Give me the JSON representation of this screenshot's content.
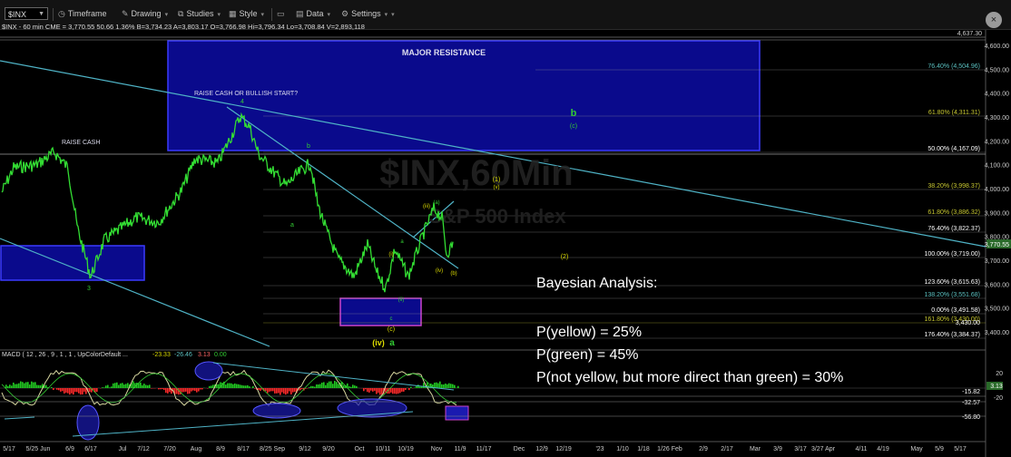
{
  "toolbar": {
    "symbol": "$INX",
    "timeframe": "Timeframe",
    "drawing": "Drawing",
    "studies": "Studies",
    "style": "Style",
    "data": "Data",
    "settings": "Settings"
  },
  "info_line": "$INX - 60 min CME = 3,770.55  50.66  1.36%   B=3,734.23  A=3,803.17  O=3,766.98  Hi=3,796.34  Lo=3,708.84  V=2,893,118",
  "watermark": {
    "symbol": "$INX,60Min",
    "name": "S&P 500 Index"
  },
  "price_axis": [
    "4,600.00",
    "4,500.00",
    "4,400.00",
    "4,300.00",
    "4,200.00",
    "4,100.00",
    "4,000.00",
    "3,900.00",
    "3,800.00",
    "3,700.00",
    "3,600.00",
    "3,500.00",
    "3,400.00"
  ],
  "price_top_label": "4,637.30",
  "current_price": "3,770.55",
  "price_tags": [
    "3,430.00"
  ],
  "fib_levels": [
    {
      "label": "76.40% (4,504.96)",
      "color": "#5bc0c0"
    },
    {
      "label": "61.80% (4,311.31)",
      "color": "#c8c832"
    },
    {
      "label": "50.00% (4,167.09)",
      "color": "#ffffff"
    },
    {
      "label": "38.20% (3,998.37)",
      "color": "#c8c832"
    },
    {
      "label": "61.80% (3,886.32)",
      "color": "#c8c832"
    },
    {
      "label": "76.40% (3,822.37)",
      "color": "#ffffff"
    },
    {
      "label": "100.00% (3,719.00)",
      "color": "#ffffff"
    },
    {
      "label": "123.60% (3,615.63)",
      "color": "#ffffff"
    },
    {
      "label": "138.20% (3,551.68)",
      "color": "#5bc0c0"
    },
    {
      "label": "0.00% (3,491.58)",
      "color": "#ffffff"
    },
    {
      "label": "161.80% (3,430.00)",
      "color": "#c8c832"
    },
    {
      "label": "176.40% (3,384.37)",
      "color": "#ffffff"
    }
  ],
  "annotations": {
    "major_resistance": "MAJOR RESISTANCE",
    "raise_cash_or_bullish": "RAISE CASH OR BULLISH START?",
    "raise_cash": "RAISE CASH",
    "wave_4": "4",
    "wave_3": "3",
    "wave_b_green": "b",
    "wave_c_green": "(c)",
    "wave_b_small": "b",
    "wave_a_small": "a",
    "wave_iii": "(iii)",
    "wave_a_paren": "(a)",
    "wave_i": "(i)",
    "wave_ii": "(ii)",
    "wave_iv_small": "(iv)",
    "wave_b_paren": "(b)",
    "wave_1": "(1)",
    "wave_v": "(v)",
    "wave_2": "(2)",
    "wave_c_bottom": "c",
    "wave_c_paren_bottom": "(c)",
    "wave_iv": "(iv)",
    "wave_a_green": "a",
    "wave_a_left": "a"
  },
  "bayesian": {
    "title": "Bayesian Analysis:",
    "line1": "P(yellow) = 25%",
    "line2": "P(green) =  45%",
    "line3": "P(not yellow, but more direct than green) = 30%"
  },
  "macd": {
    "label": "MACD ( 12 , 26 , 9 , 1 , 1 , UpColorDefault ...",
    "values": [
      "-23.33",
      "-26.46",
      "3.13",
      "0.00"
    ],
    "axis": [
      "20",
      "0",
      "-20"
    ],
    "tags": [
      "3.13",
      "-15.82",
      "-32.57",
      "-56.80"
    ]
  },
  "time_axis": [
    "5/17",
    "5/25 Jun",
    "6/9",
    "6/17",
    "Jul",
    "7/12",
    "7/20",
    "Aug",
    "8/9",
    "8/17",
    "8/25 Sep",
    "9/12",
    "9/20",
    "Oct",
    "10/11",
    "10/19",
    "Nov",
    "11/9",
    "11/17",
    "Dec",
    "12/9",
    "12/19",
    "'23",
    "1/10",
    "1/18",
    "1/26 Feb",
    "2/9",
    "2/17",
    "Mar",
    "3/9",
    "3/17",
    "3/27 Apr",
    "4/11",
    "4/19",
    "May",
    "5/9",
    "5/17"
  ],
  "colors": {
    "price": "#33dd33",
    "resistance_box": "#0a0a8c",
    "resistance_border": "#3a3aff",
    "trendline": "#4fb3c6",
    "yellow": "#dddd00",
    "green": "#33cc33",
    "macd_signal": "#d8d8a0",
    "macd_up": "#22cc22",
    "macd_down": "#ff2a2a"
  },
  "chart_data": {
    "type": "line",
    "title": "$INX - 60 min",
    "ylim": [
      3330,
      4650
    ],
    "series": [
      {
        "name": "$INX",
        "x": [
          "5/17",
          "5/25",
          "6/9",
          "6/17",
          "7/1",
          "7/12",
          "7/20",
          "8/1",
          "8/9",
          "8/17",
          "8/25",
          "9/1",
          "9/12",
          "9/20",
          "10/1",
          "10/11",
          "10/19",
          "11/1",
          "11/9"
        ],
        "values": [
          4050,
          4150,
          3800,
          3650,
          3820,
          3850,
          3960,
          4140,
          4200,
          4300,
          4150,
          3980,
          4080,
          3850,
          3620,
          3590,
          3700,
          3900,
          3770
        ]
      }
    ]
  }
}
